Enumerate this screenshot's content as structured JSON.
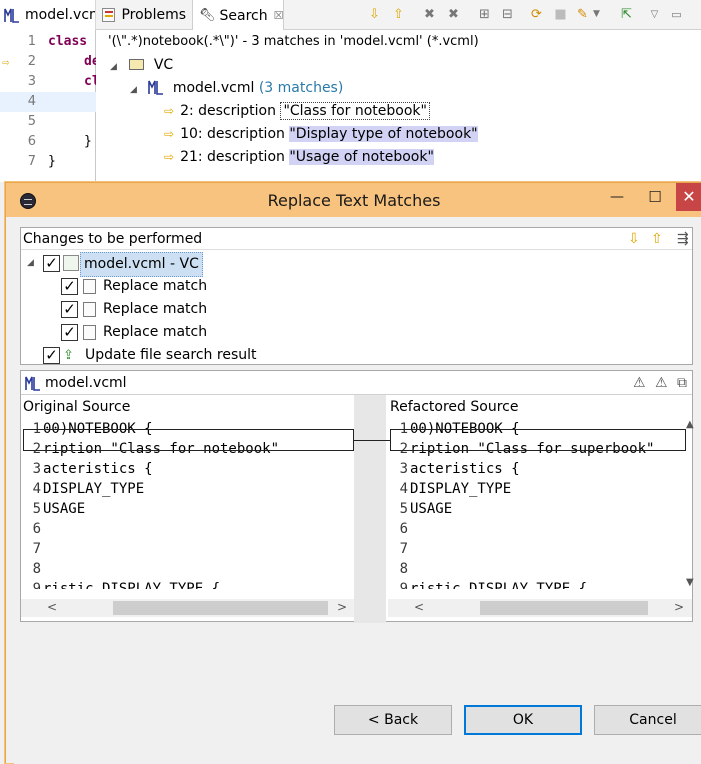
{
  "editor": {
    "tab_label": "model.vcm",
    "lines": [
      {
        "num": "1",
        "code": "class"
      },
      {
        "num": "2",
        "code": "de"
      },
      {
        "num": "3",
        "code": "cl"
      },
      {
        "num": "4",
        "code": ""
      },
      {
        "num": "5",
        "code": ""
      },
      {
        "num": "6",
        "code": "}"
      },
      {
        "num": "7",
        "code": "}"
      }
    ]
  },
  "views": {
    "problems_label": "Problems",
    "search_label": "Search",
    "close_glyph": "☒"
  },
  "search": {
    "header": "'(\\\".*)notebook(.*\\\")' - 3 matches in 'model.vcml' (*.vcml)",
    "project": "VC",
    "file": "model.vcml",
    "file_matches": "(3 matches)",
    "results": [
      {
        "prefix": "2: description ",
        "match": "\"Class for notebook\""
      },
      {
        "prefix": "10: description ",
        "match": "\"Display type of notebook\""
      },
      {
        "prefix": "21: description ",
        "match": "\"Usage of notebook\""
      }
    ]
  },
  "dialog": {
    "title": "Replace Text Matches",
    "changes_header": "Changes to be performed",
    "root_item": "model.vcml - VC",
    "child_items": [
      "Replace match",
      "Replace match",
      "Replace match"
    ],
    "update_item": "Update file search result",
    "preview_file": "model.vcml",
    "original_label": "Original Source",
    "refactored_label": "Refactored Source",
    "original_lines": [
      {
        "num": "1",
        "text": "00)NOTEBOOK {"
      },
      {
        "num": "2",
        "text": "ription \"Class for notebook\""
      },
      {
        "num": "3",
        "text": "acteristics {"
      },
      {
        "num": "4",
        "text": "DISPLAY_TYPE"
      },
      {
        "num": "5",
        "text": "USAGE"
      },
      {
        "num": "6",
        "text": ""
      },
      {
        "num": "7",
        "text": ""
      },
      {
        "num": "8",
        "text": ""
      },
      {
        "num": "9",
        "text": "ristic DISPLAY_TYPE {"
      }
    ],
    "refactored_lines": [
      {
        "num": "1",
        "text": "00)NOTEBOOK {"
      },
      {
        "num": "2",
        "text": "ription \"Class for superbook\""
      },
      {
        "num": "3",
        "text": "acteristics {"
      },
      {
        "num": "4",
        "text": "DISPLAY_TYPE"
      },
      {
        "num": "5",
        "text": "USAGE"
      },
      {
        "num": "6",
        "text": ""
      },
      {
        "num": "7",
        "text": ""
      },
      {
        "num": "8",
        "text": ""
      },
      {
        "num": "9",
        "text": "ristic DISPLAY_TYPE {"
      }
    ],
    "back_label": "< Back",
    "ok_label": "OK",
    "cancel_label": "Cancel"
  },
  "colors": {
    "titlebar": "#f8c37e",
    "match_highlight": "#d2d2f5",
    "close_button": "#c74545",
    "selection": "#cde0f3"
  }
}
